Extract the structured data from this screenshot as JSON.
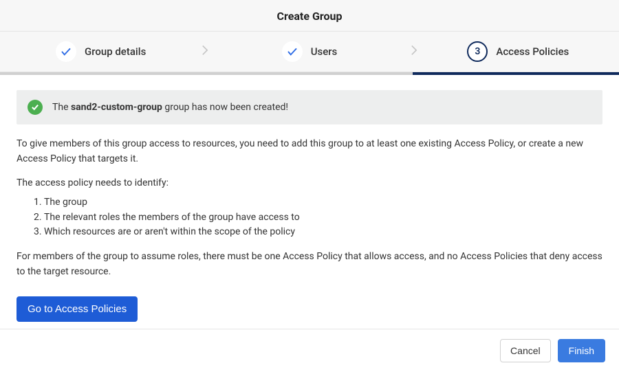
{
  "header": {
    "title": "Create Group"
  },
  "stepper": {
    "step1": {
      "label": "Group details",
      "state": "done"
    },
    "step2": {
      "label": "Users",
      "state": "done"
    },
    "step3": {
      "label": "Access Policies",
      "number": "3",
      "state": "current"
    }
  },
  "alert": {
    "prefix": "The ",
    "group_name": "sand2-custom-group",
    "suffix": " group has now been created!"
  },
  "body": {
    "intro": "To give members of this group access to resources, you need to add this group to at least one existing Access Policy, or create a new Access Policy that targets it.",
    "list_intro": "The access policy needs to identify:",
    "list": [
      "The group",
      "The relevant roles the members of the group have access to",
      "Which resources are or aren't within the scope of the policy"
    ],
    "note": "For members of the group to assume roles, there must be one Access Policy that allows access, and no Access Policies that deny access to the target resource.",
    "cta_label": "Go to Access Policies"
  },
  "footer": {
    "cancel_label": "Cancel",
    "finish_label": "Finish"
  }
}
